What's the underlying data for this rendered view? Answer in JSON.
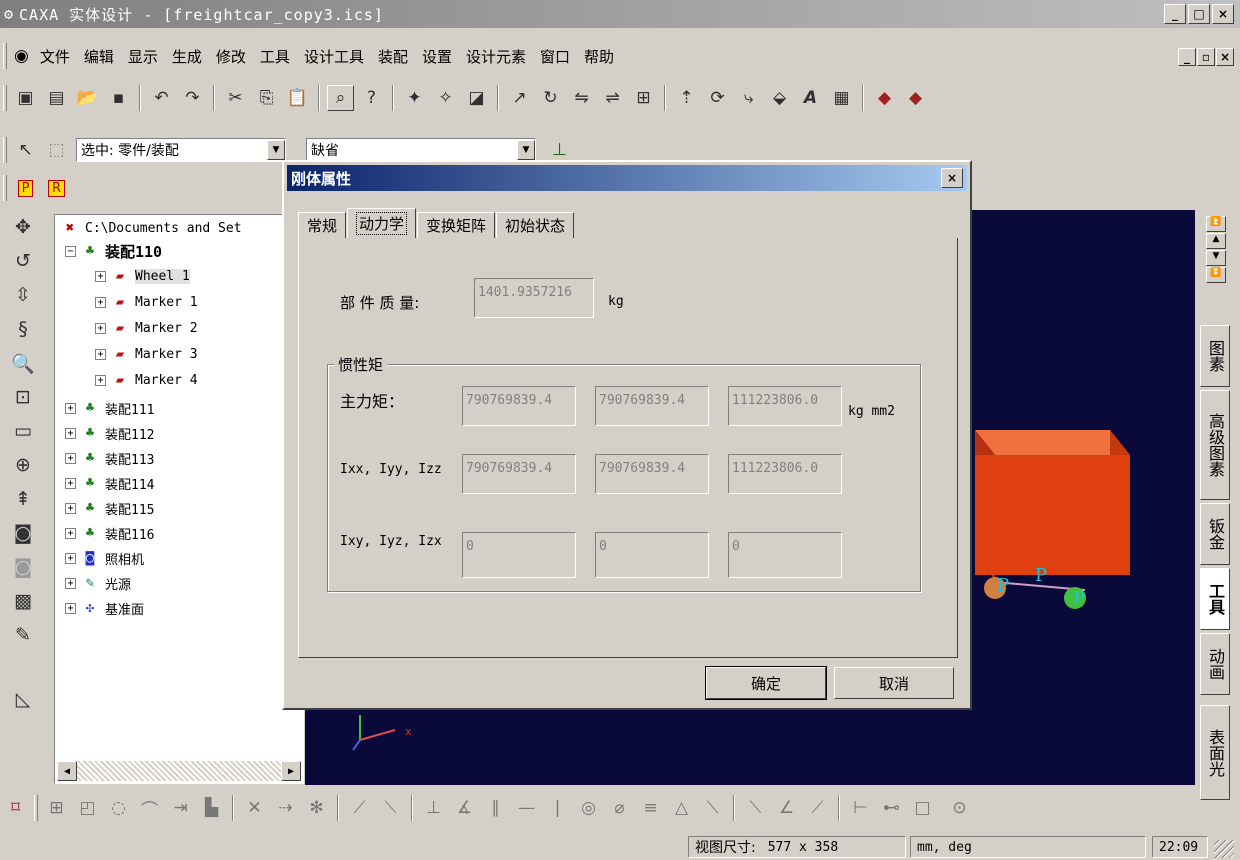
{
  "window": {
    "title": "CAXA 实体设计 - [freightcar_copy3.ics]",
    "min": "_",
    "max": "□",
    "close": "×"
  },
  "menu": [
    "文件",
    "编辑",
    "显示",
    "生成",
    "修改",
    "工具",
    "设计工具",
    "装配",
    "设置",
    "设计元素",
    "窗口",
    "帮助"
  ],
  "selbar": {
    "select_mode": "选中: 零件/装配",
    "style": "缺省",
    "btn_p": "P",
    "btn_r": "R"
  },
  "tree": {
    "root": "C:\\Documents and Set",
    "nodes": [
      {
        "label": "装配110",
        "level": 0
      },
      {
        "label": "Wheel 1",
        "level": 1
      },
      {
        "label": "Marker 1",
        "level": 1
      },
      {
        "label": "Marker 2",
        "level": 1
      },
      {
        "label": "Marker 3",
        "level": 1
      },
      {
        "label": "Marker 4",
        "level": 1
      },
      {
        "label": "装配111",
        "level": 0
      },
      {
        "label": "装配112",
        "level": 0
      },
      {
        "label": "装配113",
        "level": 0
      },
      {
        "label": "装配114",
        "level": 0
      },
      {
        "label": "装配115",
        "level": 0
      },
      {
        "label": "装配116",
        "level": 0
      },
      {
        "label": "照相机",
        "level": 0
      },
      {
        "label": "光源",
        "level": 0
      },
      {
        "label": "基准面",
        "level": 0
      }
    ]
  },
  "right_tabs": [
    "图素",
    "高级图素",
    "钣金",
    "工具",
    "动画",
    "表面光"
  ],
  "viewport": {
    "axis_x": "x",
    "marker_p": "P",
    "bg": "#0a0a3a",
    "box_color": "#e04010"
  },
  "dialog": {
    "title": "刚体属性",
    "tabs": [
      "常规",
      "动力学",
      "变换矩阵",
      "初始状态"
    ],
    "mass_label": "部 件 质 量:",
    "mass_value": "1401.9357216",
    "mass_unit": "kg",
    "inertia_group": "惯性矩",
    "principal_label": "主力矩：",
    "principal": [
      "790769839.4",
      "790769839.4",
      "111223806.0"
    ],
    "principal_unit": "kg mm2",
    "ixx_label": "Ixx, Iyy, Izz",
    "ixx": [
      "790769839.4",
      "790769839.4",
      "111223806.0"
    ],
    "ixy_label": "Ixy, Iyz, Izx",
    "ixy": [
      "0",
      "0",
      "0"
    ],
    "ok": "确定",
    "cancel": "取消"
  },
  "status": {
    "view_size_label": "视图尺寸:",
    "view_size": "577 x  358",
    "units": "mm, deg",
    "time": "22:09"
  }
}
